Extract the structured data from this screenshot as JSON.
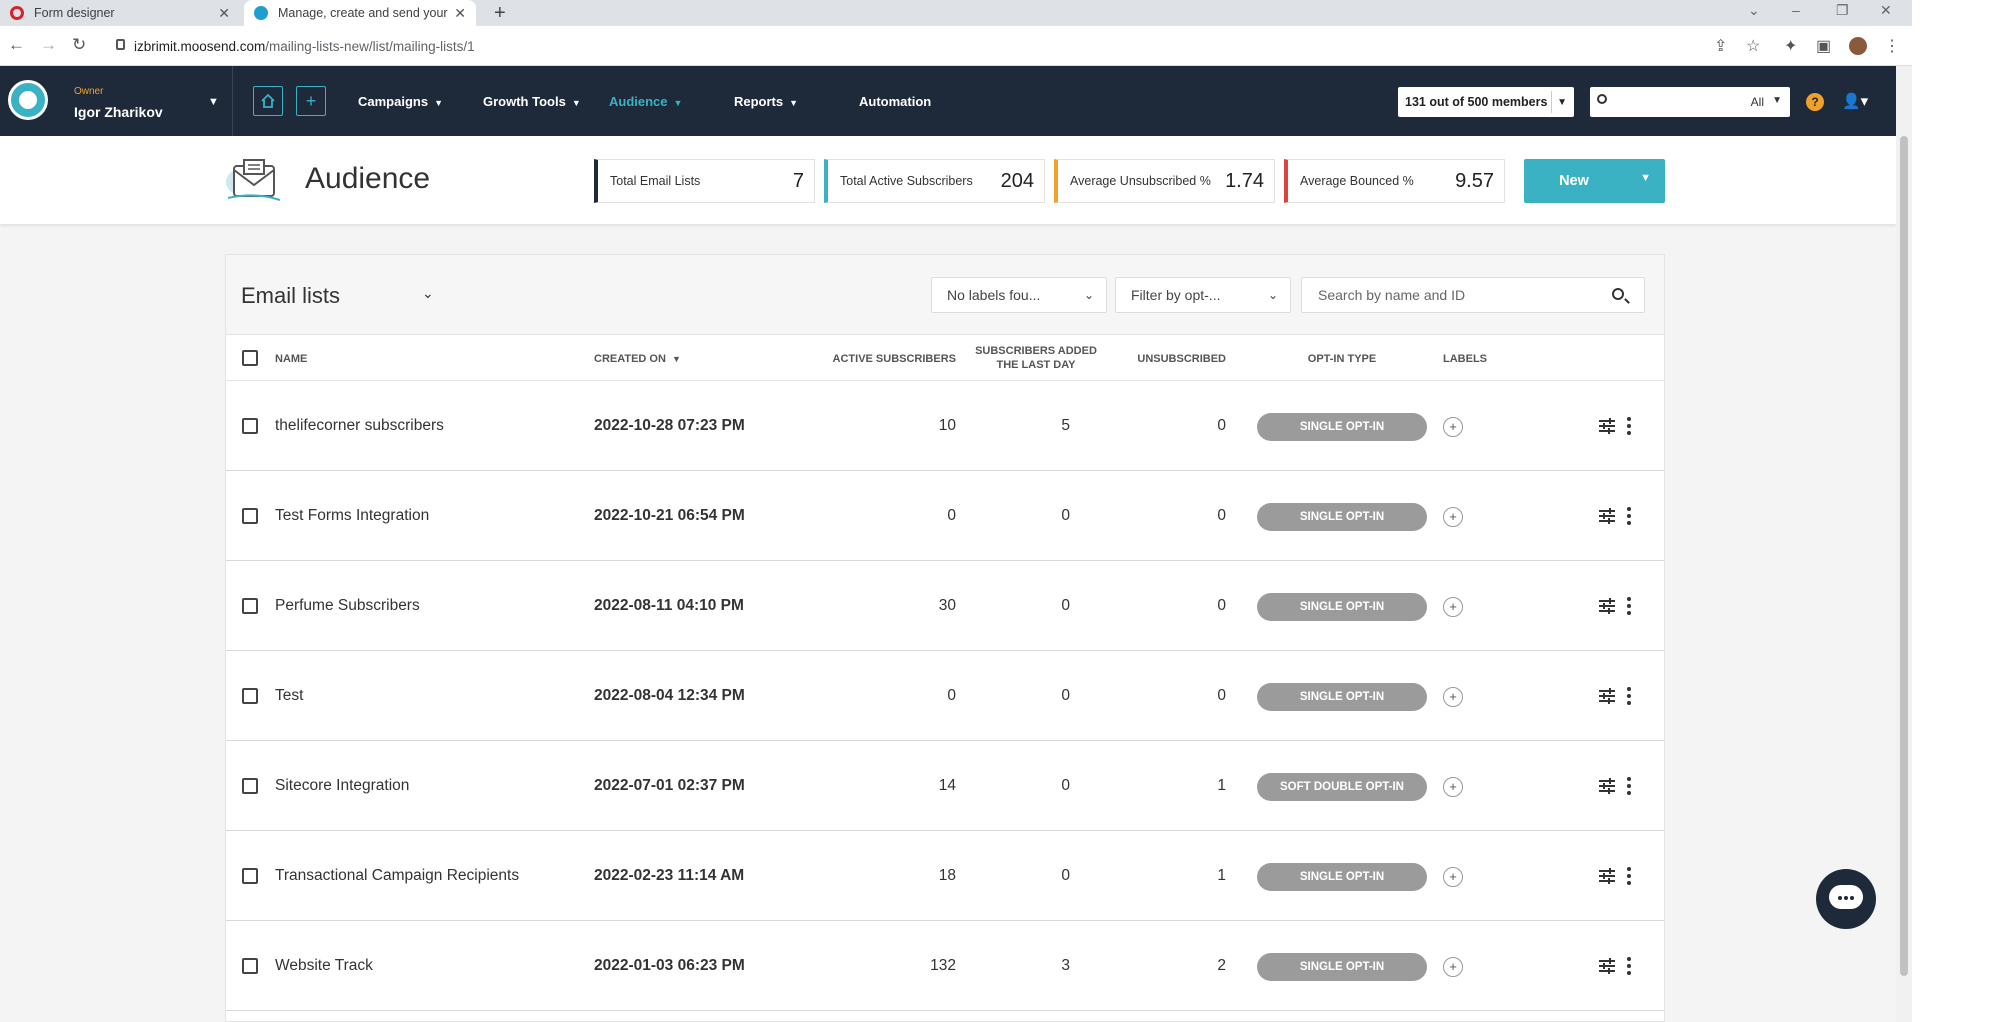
{
  "browser": {
    "tabs": [
      {
        "title": "Form designer"
      },
      {
        "title": "Manage, create and send your em"
      }
    ],
    "url_host": "izbrimit.moosend.com",
    "url_path": "/mailing-lists-new/list/mailing-lists/1"
  },
  "nav": {
    "user_role": "Owner",
    "user_name": "Igor Zharikov",
    "items": [
      "Campaigns",
      "Growth Tools",
      "Audience",
      "Reports",
      "Automation"
    ],
    "active_item": "Audience",
    "members": "131 out of 500 members",
    "search_scope": "All",
    "help": "?"
  },
  "header": {
    "title": "Audience",
    "stats": [
      {
        "label": "Total Email Lists",
        "value": "7",
        "color": "#1e2a3a"
      },
      {
        "label": "Total Active Subscribers",
        "value": "204",
        "color": "#3bb1c4"
      },
      {
        "label": "Average Unsubscribed %",
        "value": "1.74",
        "color": "#f0a12a"
      },
      {
        "label": "Average Bounced %",
        "value": "9.57",
        "color": "#d9443c"
      }
    ],
    "new_button": "New"
  },
  "panel": {
    "title": "Email lists",
    "label_filter": "No labels fou...",
    "optin_filter": "Filter by opt-...",
    "search_placeholder": "Search by name and ID",
    "columns": {
      "name": "NAME",
      "created_on": "CREATED ON",
      "active_subscribers": "ACTIVE SUBSCRIBERS",
      "added_last_day": "SUBSCRIBERS ADDED THE LAST DAY",
      "unsubscribed": "UNSUBSCRIBED",
      "optin_type": "OPT-IN TYPE",
      "labels": "LABELS"
    },
    "rows": [
      {
        "name": "thelifecorner subscribers",
        "created": "2022-10-28 07:23 PM",
        "active": "10",
        "added": "5",
        "unsub": "0",
        "optin": "SINGLE OPT-IN"
      },
      {
        "name": "Test Forms Integration",
        "created": "2022-10-21 06:54 PM",
        "active": "0",
        "added": "0",
        "unsub": "0",
        "optin": "SINGLE OPT-IN"
      },
      {
        "name": "Perfume Subscribers",
        "created": "2022-08-11 04:10 PM",
        "active": "30",
        "added": "0",
        "unsub": "0",
        "optin": "SINGLE OPT-IN"
      },
      {
        "name": "Test",
        "created": "2022-08-04 12:34 PM",
        "active": "0",
        "added": "0",
        "unsub": "0",
        "optin": "SINGLE OPT-IN"
      },
      {
        "name": "Sitecore Integration",
        "created": "2022-07-01 02:37 PM",
        "active": "14",
        "added": "0",
        "unsub": "1",
        "optin": "SOFT DOUBLE OPT-IN"
      },
      {
        "name": "Transactional Campaign Recipients",
        "created": "2022-02-23 11:14 AM",
        "active": "18",
        "added": "0",
        "unsub": "1",
        "optin": "SINGLE OPT-IN"
      },
      {
        "name": "Website Track",
        "created": "2022-01-03 06:23 PM",
        "active": "132",
        "added": "3",
        "unsub": "2",
        "optin": "SINGLE OPT-IN"
      }
    ]
  },
  "colors": {
    "nav_bg": "#1e2a3a",
    "accent": "#3bb1c4",
    "optin_pill": "#9b9b9b"
  }
}
